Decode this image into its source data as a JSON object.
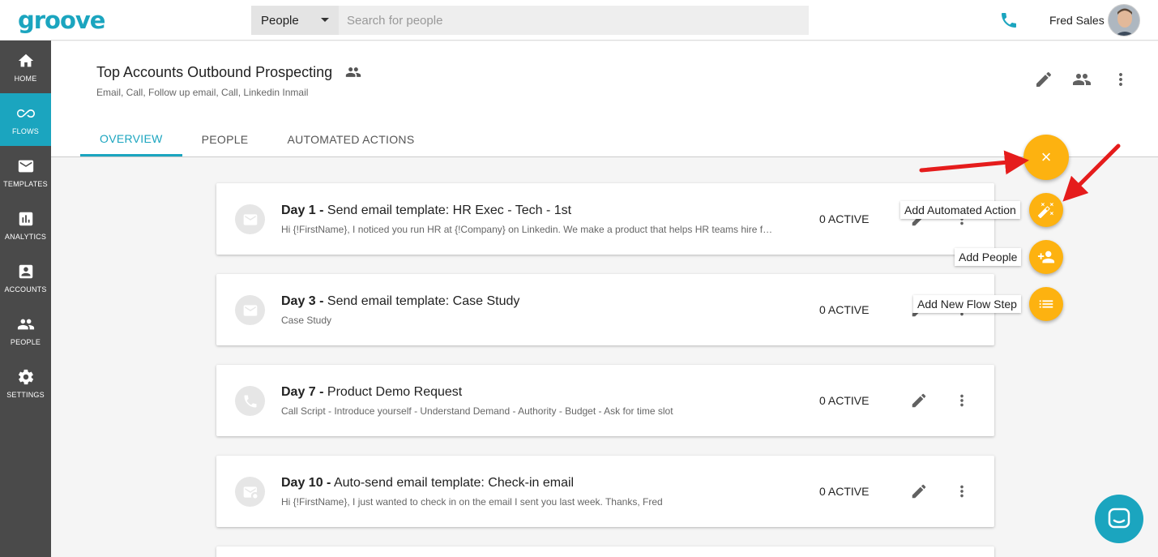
{
  "brand": {
    "logo": "groove",
    "accent": "#1ba5bf",
    "fab_color": "#fdb210"
  },
  "topbar": {
    "search_scope": "People",
    "search_placeholder": "Search for people",
    "user_name": "Fred Sales"
  },
  "sidebar": {
    "items": [
      {
        "label": "HOME",
        "icon": "home-icon"
      },
      {
        "label": "FLOWS",
        "icon": "infinity-icon",
        "active": true
      },
      {
        "label": "TEMPLATES",
        "icon": "envelope-icon"
      },
      {
        "label": "ANALYTICS",
        "icon": "bar-chart-icon"
      },
      {
        "label": "ACCOUNTS",
        "icon": "account-box-icon"
      },
      {
        "label": "PEOPLE",
        "icon": "people-icon"
      },
      {
        "label": "SETTINGS",
        "icon": "gear-icon"
      }
    ]
  },
  "flow": {
    "title": "Top Accounts Outbound Prospecting",
    "subtitle": "Email, Call, Follow up email, Call, Linkedin Inmail",
    "tabs": [
      "OVERVIEW",
      "PEOPLE",
      "AUTOMATED ACTIONS"
    ]
  },
  "steps": [
    {
      "day": "Day 1 -",
      "title": "Send email template: HR Exec - Tech - 1st",
      "desc": "Hi {!FirstName}, I noticed you run HR at {!Company} on Linkedin.  We make a product that helps HR teams hire faster and smarter...",
      "status": "0 ACTIVE",
      "icon": "email-icon"
    },
    {
      "day": "Day 3 -",
      "title": "Send email template: Case Study",
      "desc": "Case Study",
      "status": "0 ACTIVE",
      "icon": "email-icon"
    },
    {
      "day": "Day 7 -",
      "title": "Product Demo Request",
      "desc": "Call Script - Introduce yourself - Understand Demand - Authority - Budget - Ask for time slot",
      "status": "0 ACTIVE",
      "icon": "phone-icon"
    },
    {
      "day": "Day 10 -",
      "title": "Auto-send email template: Check-in email",
      "desc": "Hi {!FirstName}, I just wanted to check in on the email I sent you last week. Thanks, Fred",
      "status": "0 ACTIVE",
      "icon": "auto-email-icon"
    }
  ],
  "fab": {
    "close_glyph": "×",
    "actions": [
      {
        "label": "Add Automated Action",
        "icon": "magic-wand-icon"
      },
      {
        "label": "Add People",
        "icon": "person-add-icon"
      },
      {
        "label": "Add New Flow Step",
        "icon": "list-icon"
      }
    ]
  }
}
